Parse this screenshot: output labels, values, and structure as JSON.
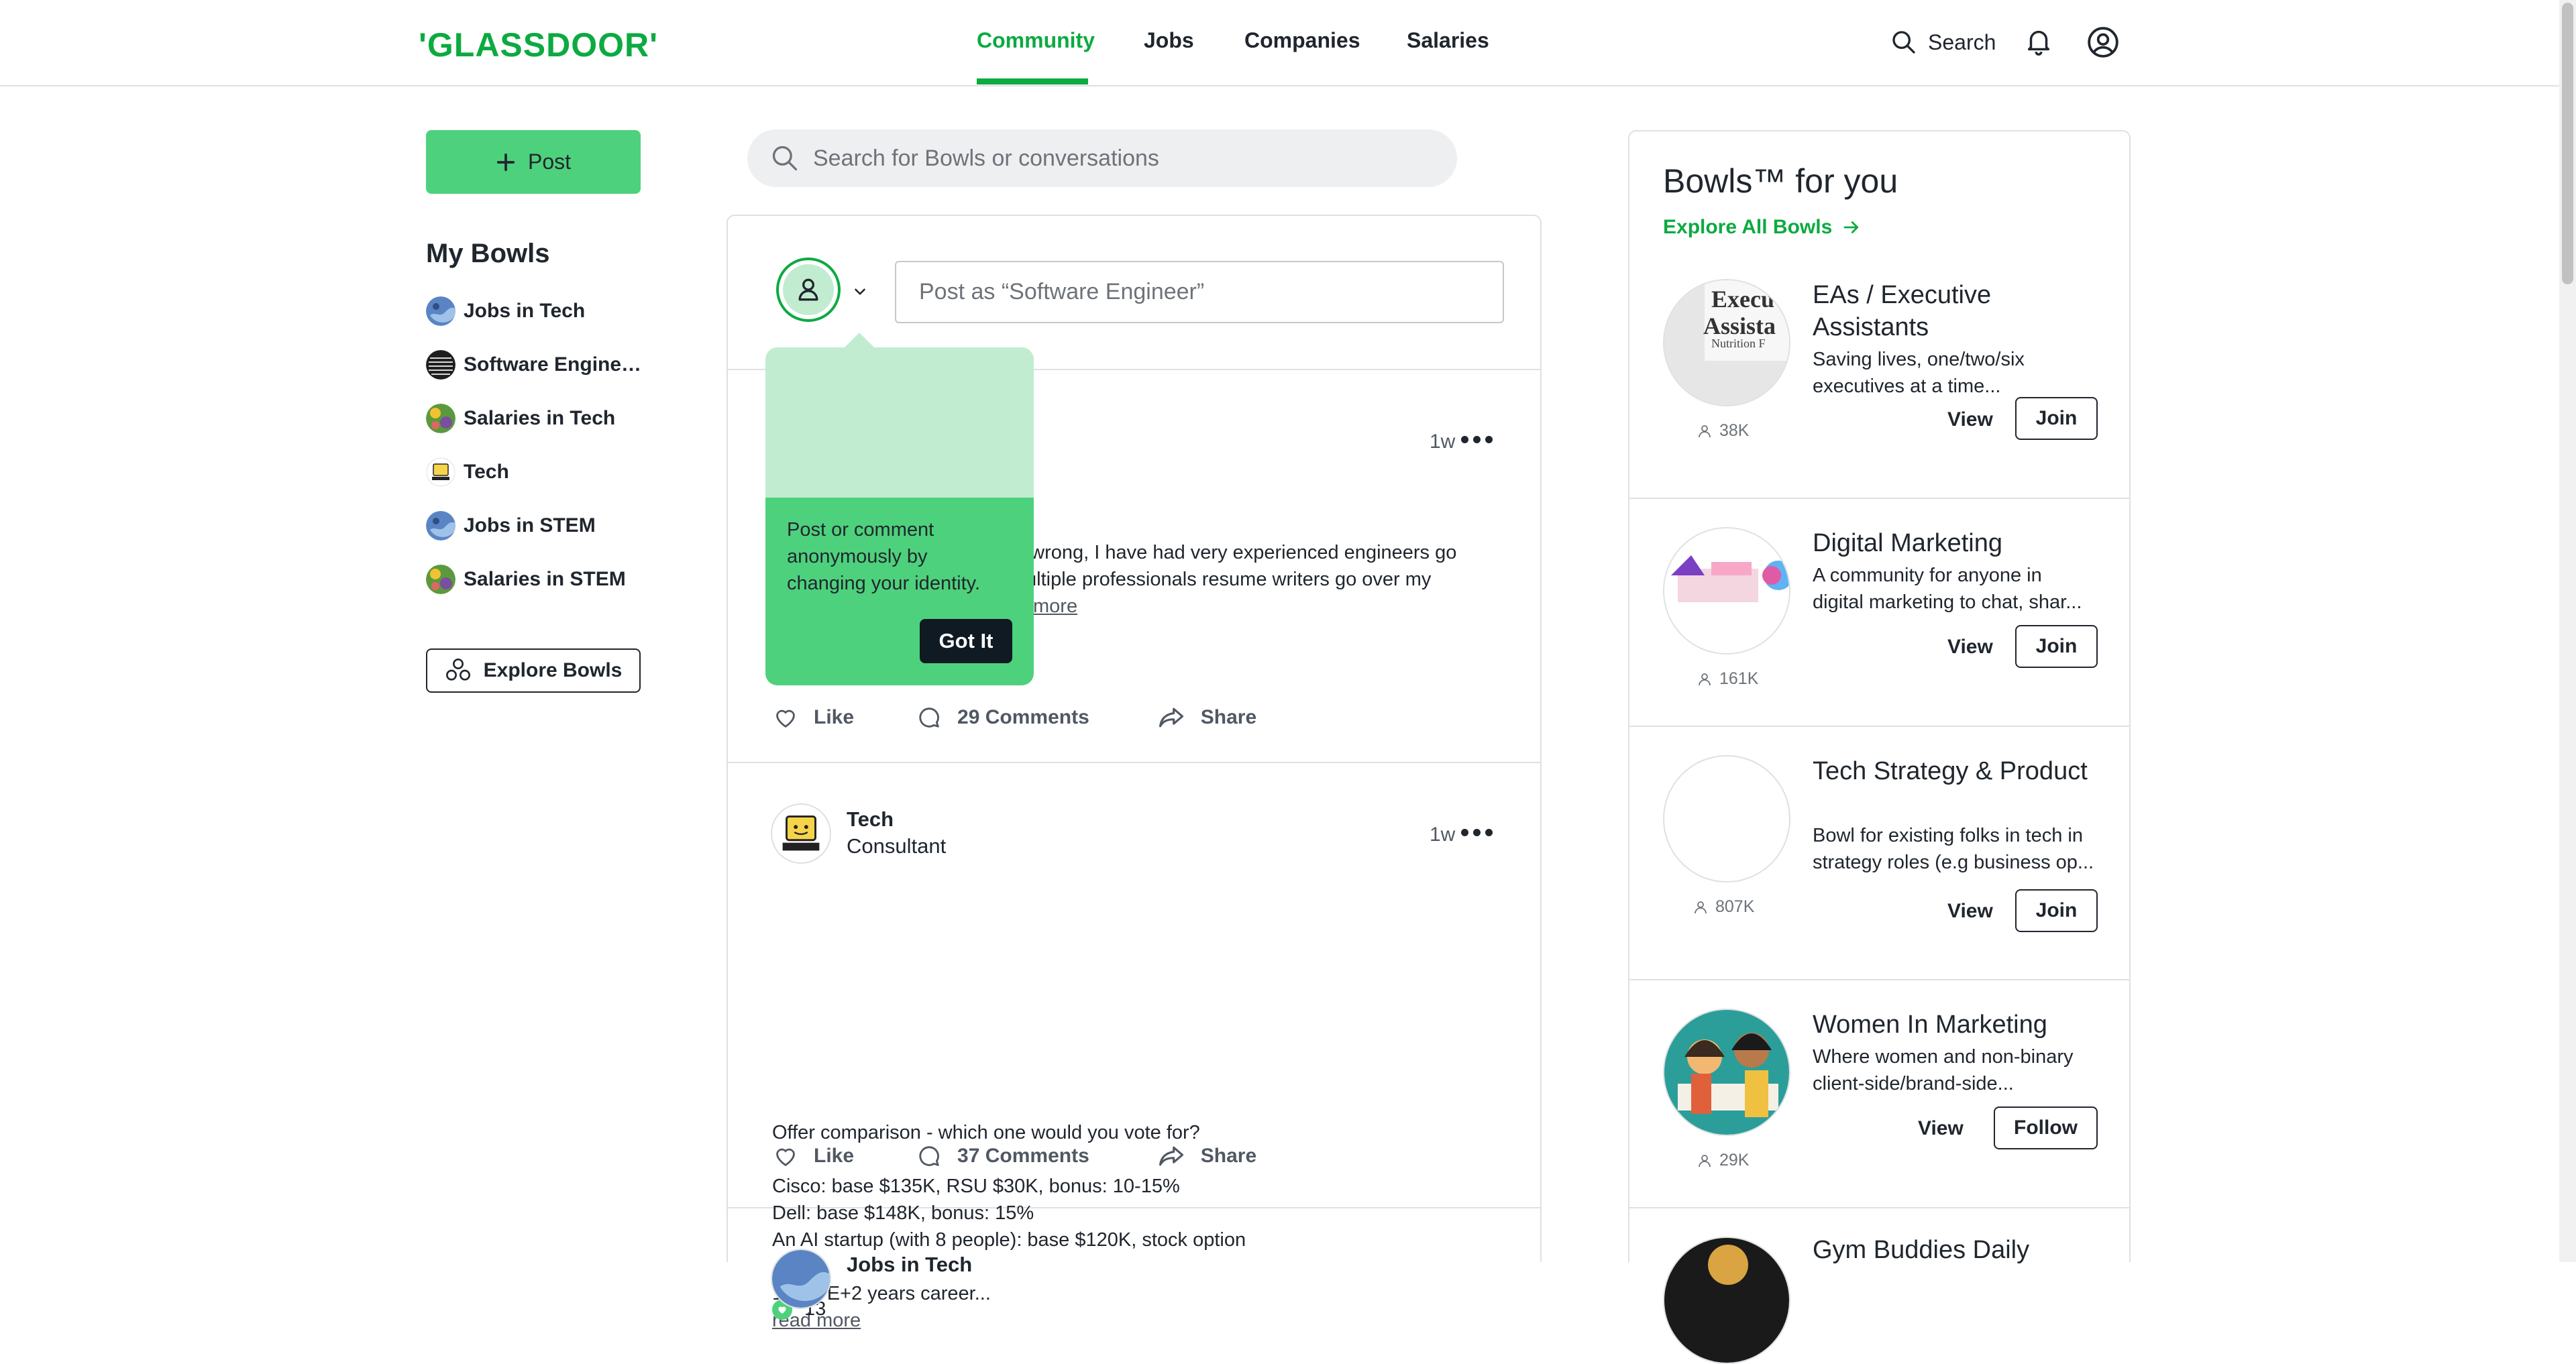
{
  "nav": {
    "logo": "'GLASSDOOR'",
    "links": [
      "Community",
      "Jobs",
      "Companies",
      "Salaries"
    ],
    "search_label": "Search",
    "accent": "#0caa41"
  },
  "sidebar": {
    "post_label": "Post",
    "my_bowls_title": "My Bowls",
    "bowls": [
      {
        "label": "Jobs in Tech",
        "icon": "globe-icon"
      },
      {
        "label": "Software Engineer...",
        "icon": "code-icon"
      },
      {
        "label": "Salaries in Tech",
        "icon": "money-icon"
      },
      {
        "label": "Tech",
        "icon": "computer-icon"
      },
      {
        "label": "Jobs in STEM",
        "icon": "globe-icon"
      },
      {
        "label": "Salaries in STEM",
        "icon": "money-icon"
      }
    ],
    "explore_label": "Explore Bowls"
  },
  "search": {
    "placeholder": "Search for Bowls or conversations"
  },
  "composer": {
    "placeholder": "Post as “Software Engineer”"
  },
  "tooltip": {
    "text": "Post or comment anonymously by changing your identity.",
    "button": "Got It"
  },
  "posts": [
    {
      "bowl_partial": "g",
      "time": "1w",
      "body_line1": "g wrong, I have had very experienced engineers go",
      "body_line2": "ultiple professionals resume writers go over my",
      "read_more": "more",
      "like": "Like",
      "comments": "29 Comments",
      "share": "Share"
    },
    {
      "bowl": "Tech",
      "role": "Consultant",
      "time": "1w",
      "body": "Offer comparison - which one would you vote for?\n\nCisco: base $135K, RSU $30K, bonus: 10-15%\nDell: base $148K, bonus: 15%\nAn AI startup (with 8 people): base $120K, stock option\n\n12 YOE+2 years career...",
      "read_more": "read more",
      "reactions": "13",
      "like": "Like",
      "comments": "37 Comments",
      "share": "Share"
    },
    {
      "bowl_partial": "Jobs in Tech"
    }
  ],
  "rail": {
    "title": "Bowls™ for you",
    "explore": "Explore All Bowls",
    "bowls": [
      {
        "name": "EAs / Executive Assistants",
        "desc": "Saving lives, one/two/six executives at a time...",
        "count": "38K",
        "view": "View",
        "action": "Join",
        "img_text": "Execu Assista Nutrition F"
      },
      {
        "name": "Digital Marketing",
        "desc": "A community for anyone in digital marketing to chat, shar...",
        "count": "161K",
        "view": "View",
        "action": "Join"
      },
      {
        "name": "Tech Strategy & Product",
        "desc": "Bowl for existing folks in tech in strategy roles (e.g business op...",
        "count": "807K",
        "view": "View",
        "action": "Join"
      },
      {
        "name": "Women In Marketing",
        "desc": "Where women and non-binary client-side/brand-side...",
        "count": "29K",
        "view": "View",
        "action": "Follow"
      },
      {
        "name": "Gym Buddies Daily"
      }
    ]
  }
}
